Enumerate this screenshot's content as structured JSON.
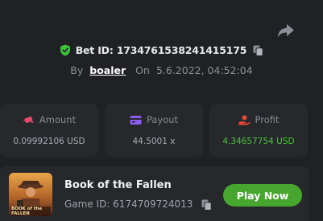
{
  "bet": {
    "id_label": "Bet ID: 1734761538241415175",
    "by_label": "By",
    "username": "boaler",
    "on_label": "On",
    "date": "5.6.2022, 04:52:04"
  },
  "stats": [
    {
      "label": "Amount",
      "value": "0.09992106 USD",
      "icon": "money-wings-icon"
    },
    {
      "label": "Payout",
      "value": "44.5001 x",
      "icon": "card-icon"
    },
    {
      "label": "Profit",
      "value": "4.34657754 USD",
      "icon": "hand-coin-icon"
    }
  ],
  "game": {
    "title": "Book of the Fallen",
    "id_label": "Game ID: 6174709724013",
    "thumbnail_text": "BOOK of the FALLEN",
    "play_label": "Play Now"
  },
  "colors": {
    "background": "#1f2124",
    "card": "#26282c",
    "accent_green": "#46a62e",
    "profit_green": "#4cc43c",
    "amount_icon": "#e84a6a",
    "payout_icon": "#8a5cf0",
    "profit_icon": "#e8483a"
  }
}
